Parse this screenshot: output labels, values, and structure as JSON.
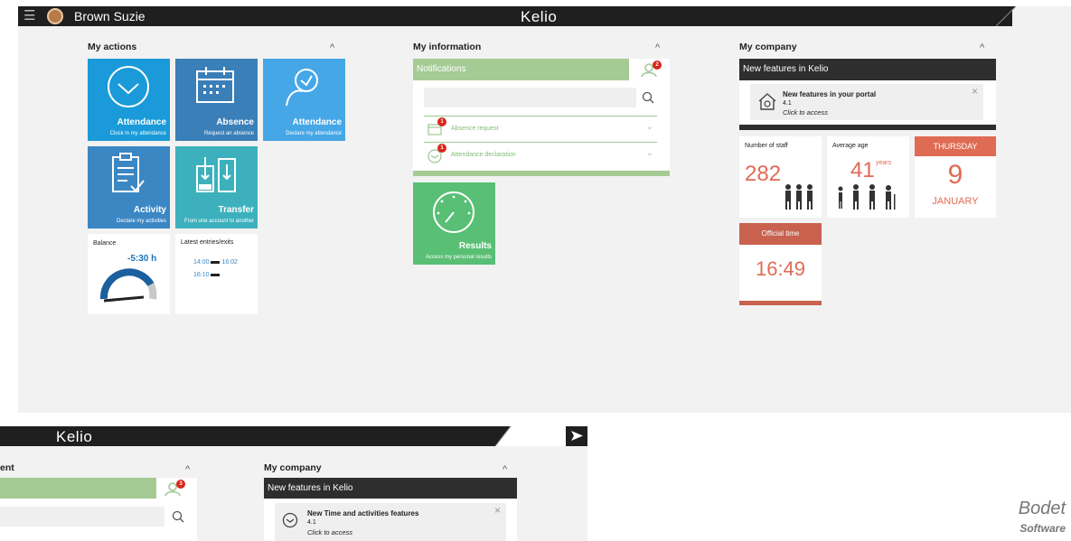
{
  "main": {
    "user_name": "Brown Suzie",
    "logo": "Kelio",
    "my_actions": {
      "title": "My actions",
      "collapse": "^",
      "tiles": [
        {
          "label": "Attendance",
          "sub": "Clock in my attendance",
          "color": "#1a9ad8"
        },
        {
          "label": "Absence",
          "sub": "Request an absence",
          "color": "#3b7fb8"
        },
        {
          "label": "Attendance",
          "sub": "Declare my attendance",
          "color": "#46a7e6"
        },
        {
          "label": "Activity",
          "sub": "Declare my activities",
          "color": "#3b87c4"
        },
        {
          "label": "Transfer",
          "sub": "From one account to another",
          "color": "#3cb1bd"
        }
      ],
      "balance": {
        "label": "Balance",
        "value": "-5:30 h"
      },
      "entries": {
        "label": "Latest entries/exits",
        "row1_in": "14:00",
        "row1_out": "16:02",
        "row2_in": "16:10"
      }
    },
    "my_information": {
      "title": "My information",
      "collapse": "^",
      "notifications_label": "Notifications",
      "notifications_count": "2",
      "rows": [
        {
          "label": "Absence request",
          "count": "1"
        },
        {
          "label": "Attendance declaration",
          "count": "1"
        }
      ],
      "results": {
        "label": "Results",
        "sub": "Access my personal results"
      }
    },
    "my_company": {
      "title": "My company",
      "collapse": "^",
      "news_header": "New features in Kelio",
      "news_title": "New features in your portal",
      "news_version": "4.1",
      "news_cta": "Click to access",
      "close": "×",
      "staff": {
        "label": "Number of staff",
        "value": "282"
      },
      "age": {
        "label": "Average age",
        "value": "41",
        "unit": "years"
      },
      "date": {
        "weekday": "THURSDAY",
        "day": "9",
        "month": "JANUARY"
      },
      "time": {
        "label": "Official time",
        "value": "16:49"
      }
    }
  },
  "back": {
    "logo": "Kelio",
    "partial_title": "ent",
    "collapse": "^",
    "notifications_count": "3",
    "company_title": "My company",
    "company_collapse": "^",
    "news_header": "New features in Kelio",
    "news_title": "New Time and activities features",
    "news_version": "4.1",
    "news_cta": "Click to access",
    "close": "×"
  },
  "watermark": {
    "brand": "Bodet",
    "tagline": "Software"
  },
  "colors": {
    "topbar": "#1f1f1f",
    "green": "#a4cb94",
    "green_tile": "#58bf74",
    "orange": "#e06b54",
    "dark_header": "#2e2e2e"
  }
}
